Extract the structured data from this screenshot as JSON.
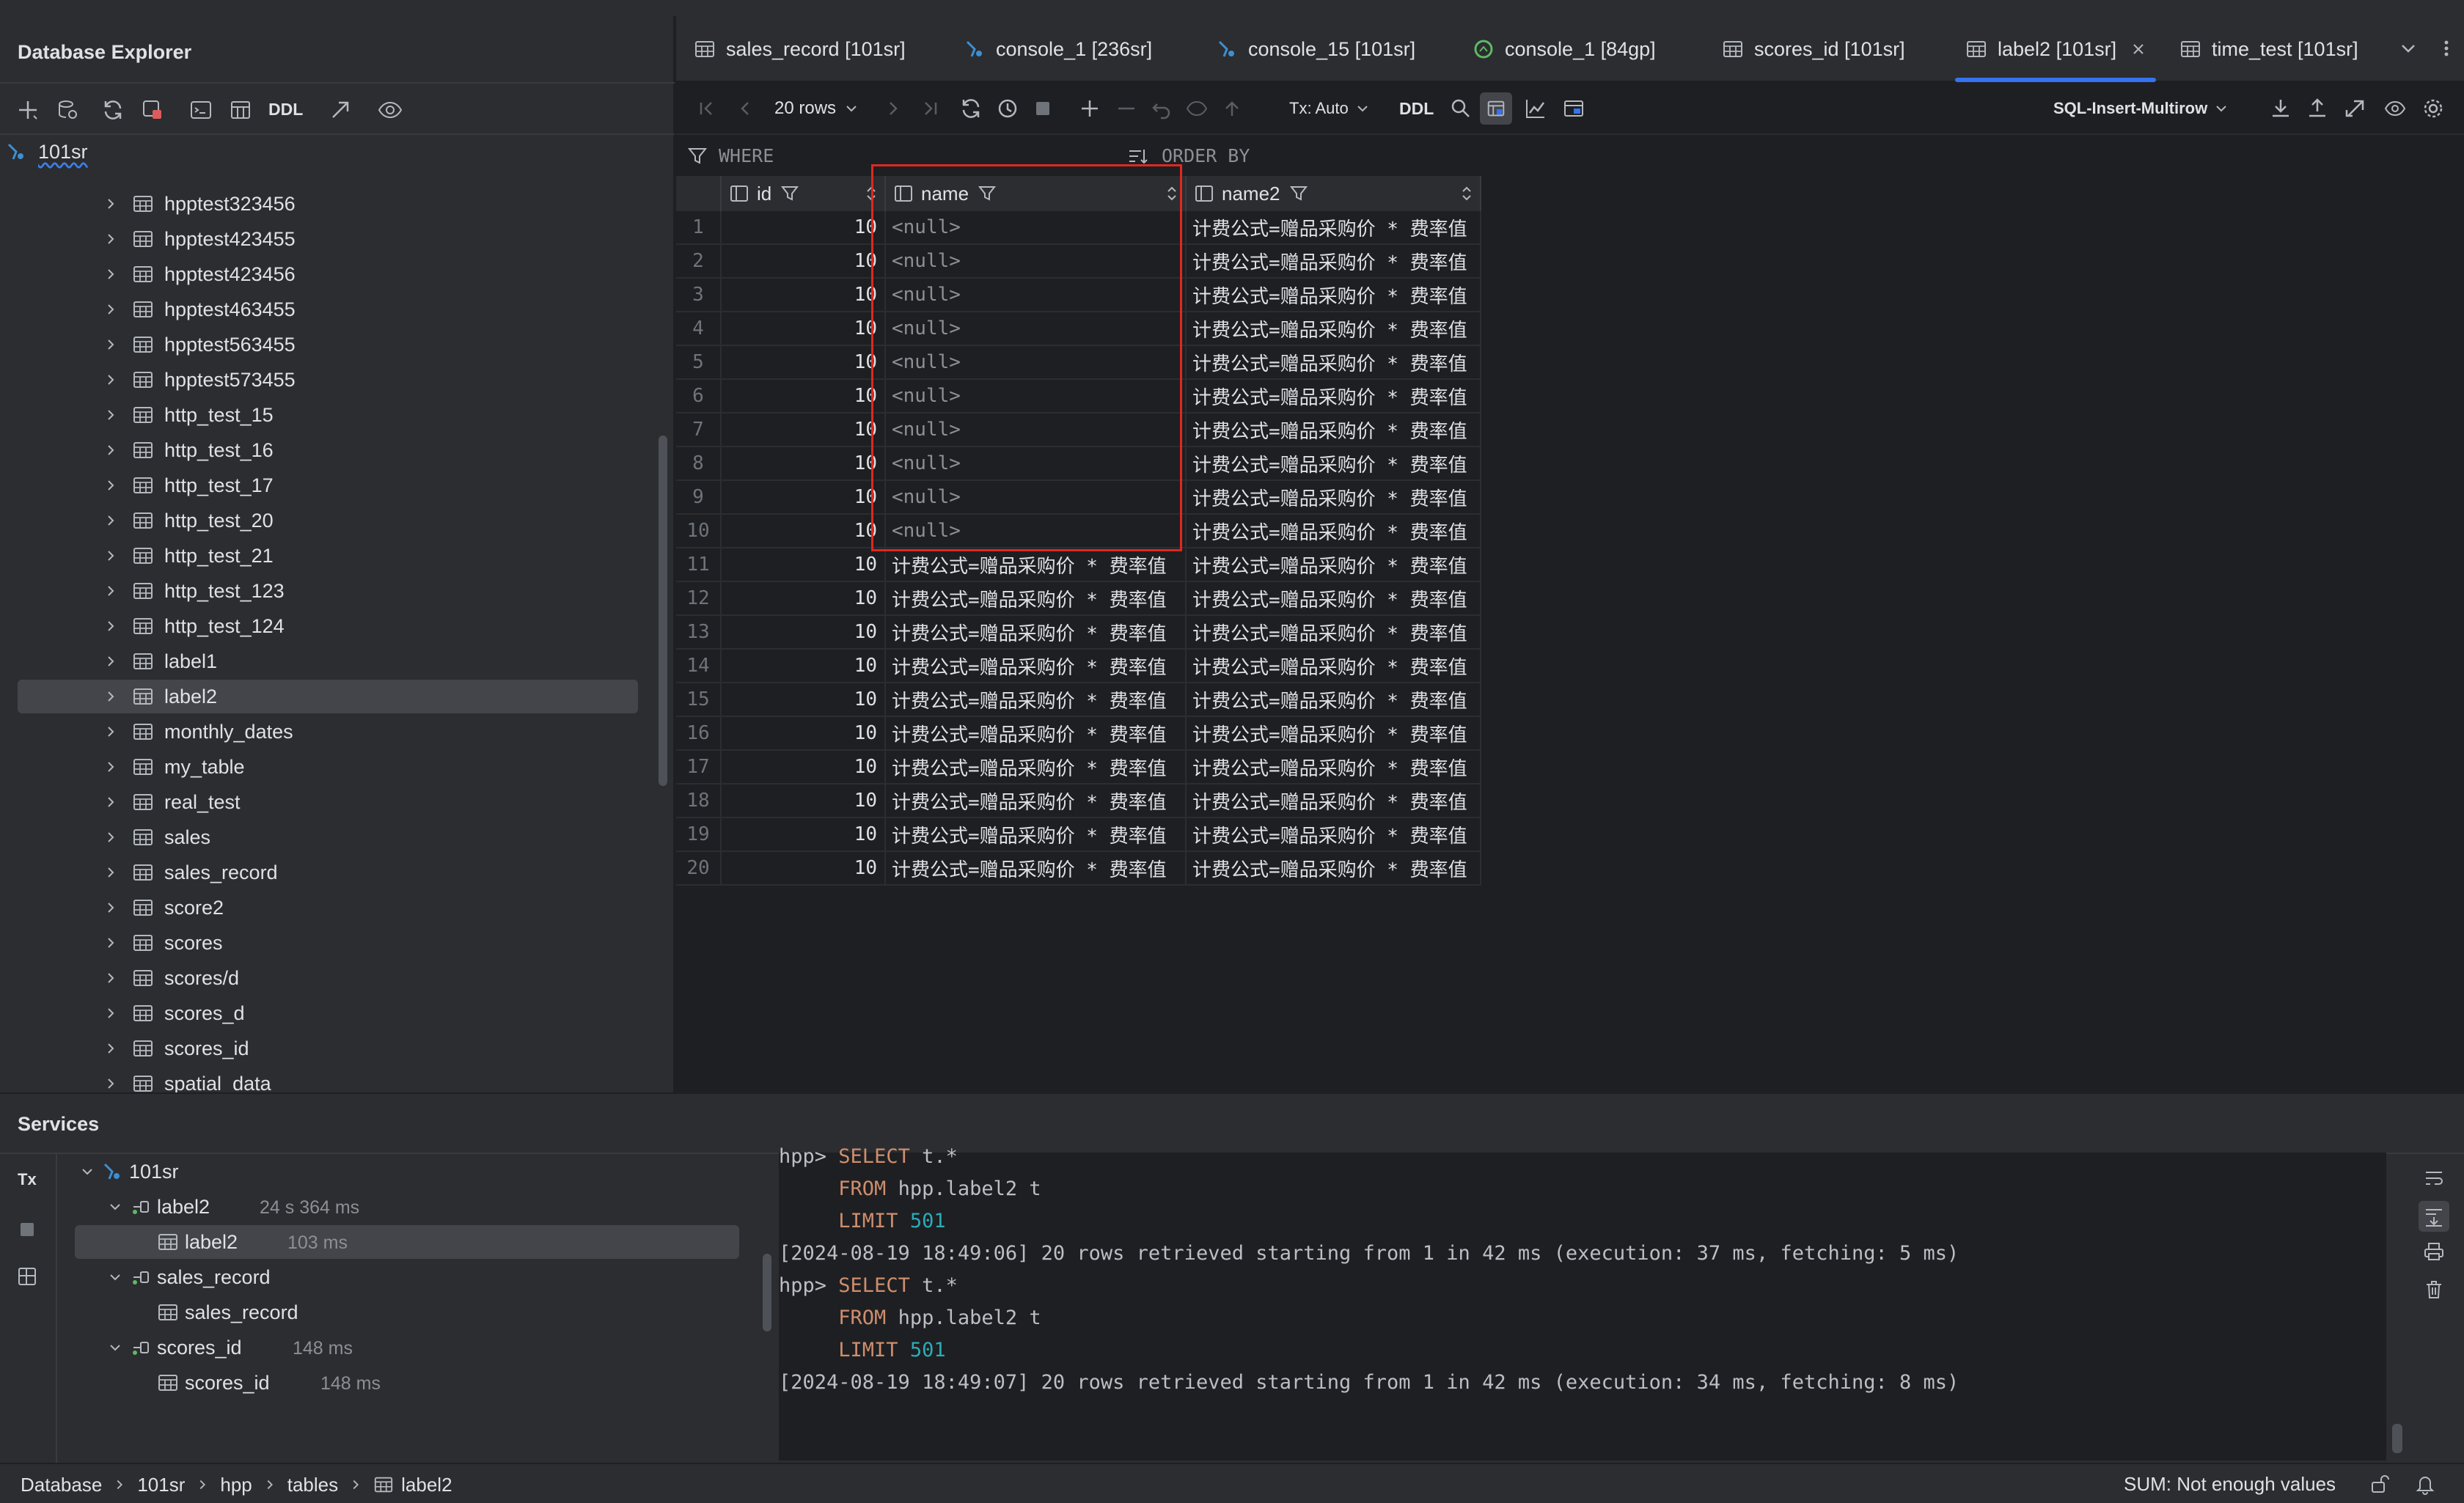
{
  "explorer": {
    "title": "Database Explorer",
    "toolbar_ddl": "DDL",
    "root": "101sr",
    "tables": [
      "hpptest323456",
      "hpptest423455",
      "hpptest423456",
      "hpptest463455",
      "hpptest563455",
      "hpptest573455",
      "http_test_15",
      "http_test_16",
      "http_test_17",
      "http_test_20",
      "http_test_21",
      "http_test_123",
      "http_test_124",
      "label1",
      "label2",
      "monthly_dates",
      "my_table",
      "real_test",
      "sales",
      "sales_record",
      "score2",
      "scores",
      "scores/d",
      "scores_d",
      "scores_id",
      "spatial_data"
    ],
    "selected_table": "label2"
  },
  "tabs": [
    {
      "label": "sales_record [101sr]",
      "icon": "table-icon"
    },
    {
      "label": "console_1 [236sr]",
      "icon": "console-icon"
    },
    {
      "label": "console_15 [101sr]",
      "icon": "console-icon"
    },
    {
      "label": "console_1 [84gp]",
      "icon": "console-green-icon"
    },
    {
      "label": "scores_id [101sr]",
      "icon": "table-icon"
    },
    {
      "label": "label2 [101sr]",
      "icon": "table-icon",
      "active": true
    },
    {
      "label": "time_test [101sr]",
      "icon": "table-icon"
    }
  ],
  "toolbar": {
    "rows": "20 rows",
    "tx": "Tx: Auto",
    "ddl": "DDL",
    "export_format": "SQL-Insert-Multirow"
  },
  "filter": {
    "where": "WHERE",
    "order_by": "ORDER BY"
  },
  "grid": {
    "columns": [
      "id",
      "name",
      "name2"
    ],
    "rows": [
      {
        "n": "1",
        "id": "10",
        "name": "<null>",
        "name2": "计费公式=赠品采购价 * 费率值"
      },
      {
        "n": "2",
        "id": "10",
        "name": "<null>",
        "name2": "计费公式=赠品采购价 * 费率值"
      },
      {
        "n": "3",
        "id": "10",
        "name": "<null>",
        "name2": "计费公式=赠品采购价 * 费率值"
      },
      {
        "n": "4",
        "id": "10",
        "name": "<null>",
        "name2": "计费公式=赠品采购价 * 费率值"
      },
      {
        "n": "5",
        "id": "10",
        "name": "<null>",
        "name2": "计费公式=赠品采购价 * 费率值"
      },
      {
        "n": "6",
        "id": "10",
        "name": "<null>",
        "name2": "计费公式=赠品采购价 * 费率值"
      },
      {
        "n": "7",
        "id": "10",
        "name": "<null>",
        "name2": "计费公式=赠品采购价 * 费率值"
      },
      {
        "n": "8",
        "id": "10",
        "name": "<null>",
        "name2": "计费公式=赠品采购价 * 费率值"
      },
      {
        "n": "9",
        "id": "10",
        "name": "<null>",
        "name2": "计费公式=赠品采购价 * 费率值"
      },
      {
        "n": "10",
        "id": "10",
        "name": "<null>",
        "name2": "计费公式=赠品采购价 * 费率值"
      },
      {
        "n": "11",
        "id": "10",
        "name": "计费公式=赠品采购价 * 费率值",
        "name2": "计费公式=赠品采购价 * 费率值"
      },
      {
        "n": "12",
        "id": "10",
        "name": "计费公式=赠品采购价 * 费率值",
        "name2": "计费公式=赠品采购价 * 费率值"
      },
      {
        "n": "13",
        "id": "10",
        "name": "计费公式=赠品采购价 * 费率值",
        "name2": "计费公式=赠品采购价 * 费率值"
      },
      {
        "n": "14",
        "id": "10",
        "name": "计费公式=赠品采购价 * 费率值",
        "name2": "计费公式=赠品采购价 * 费率值"
      },
      {
        "n": "15",
        "id": "10",
        "name": "计费公式=赠品采购价 * 费率值",
        "name2": "计费公式=赠品采购价 * 费率值"
      },
      {
        "n": "16",
        "id": "10",
        "name": "计费公式=赠品采购价 * 费率值",
        "name2": "计费公式=赠品采购价 * 费率值"
      },
      {
        "n": "17",
        "id": "10",
        "name": "计费公式=赠品采购价 * 费率值",
        "name2": "计费公式=赠品采购价 * 费率值"
      },
      {
        "n": "18",
        "id": "10",
        "name": "计费公式=赠品采购价 * 费率值",
        "name2": "计费公式=赠品采购价 * 费率值"
      },
      {
        "n": "19",
        "id": "10",
        "name": "计费公式=赠品采购价 * 费率值",
        "name2": "计费公式=赠品采购价 * 费率值"
      },
      {
        "n": "20",
        "id": "10",
        "name": "计费公式=赠品采购价 * 费率值",
        "name2": "计费公式=赠品采购价 * 费率值"
      }
    ],
    "highlight_color": "#e0281f"
  },
  "services": {
    "title": "Services",
    "tx_label": "Tx",
    "tree": [
      {
        "label": "101sr",
        "time": "",
        "level": 0,
        "kind": "connection"
      },
      {
        "label": "label2",
        "time": "24 s 364 ms",
        "level": 1,
        "kind": "session"
      },
      {
        "label": "label2",
        "time": "103 ms",
        "level": 2,
        "kind": "table",
        "selected": true
      },
      {
        "label": "sales_record",
        "time": "",
        "level": 1,
        "kind": "session"
      },
      {
        "label": "sales_record",
        "time": "",
        "level": 2,
        "kind": "table"
      },
      {
        "label": "scores_id",
        "time": "148 ms",
        "level": 1,
        "kind": "session"
      },
      {
        "label": "scores_id",
        "time": "148 ms",
        "level": 2,
        "kind": "table"
      }
    ],
    "console": {
      "prompt": "hpp>",
      "select_kw": "SELECT",
      "select_rest": "t.*",
      "from_kw": "FROM",
      "from_rest": "hpp.label2 t",
      "limit_kw": "LIMIT",
      "limit_val": "501",
      "log1": "[2024-08-19 18:49:06] 20 rows retrieved starting from 1 in 42 ms (execution: 37 ms, fetching: 5 ms)",
      "log2": "[2024-08-19 18:49:07] 20 rows retrieved starting from 1 in 42 ms (execution: 34 ms, fetching: 8 ms)"
    }
  },
  "status": {
    "breadcrumb": [
      "Database",
      "101sr",
      "hpp",
      "tables",
      "label2"
    ],
    "sum": "SUM: Not enough values"
  }
}
